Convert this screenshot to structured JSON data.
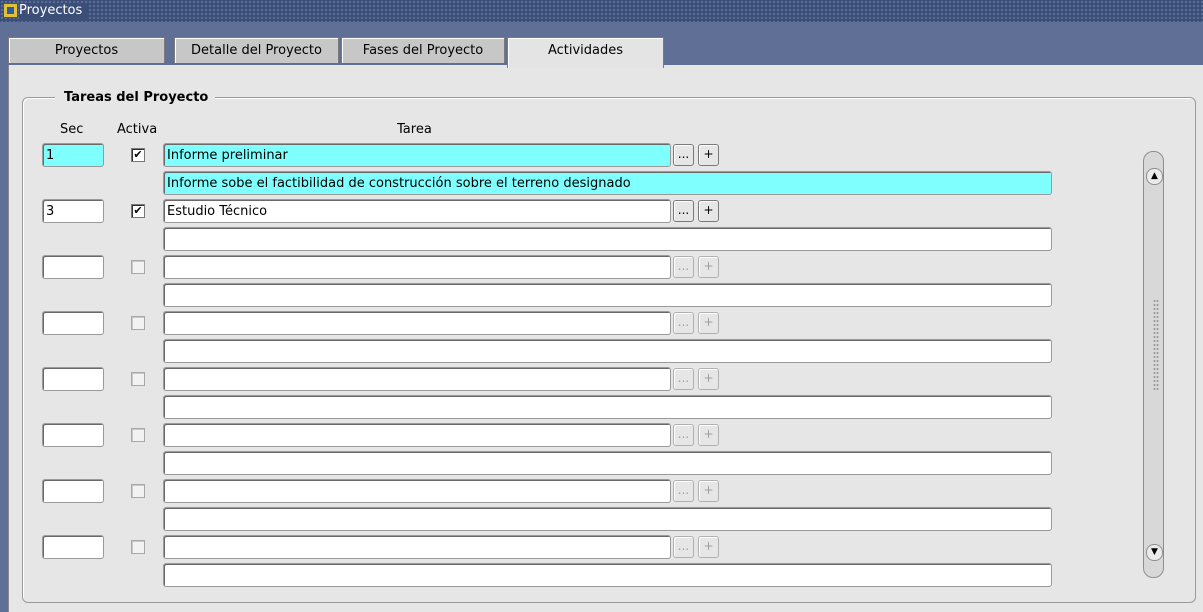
{
  "window": {
    "title": "Proyectos"
  },
  "tabs": [
    {
      "label": "Proyectos"
    },
    {
      "label": "Detalle del Proyecto"
    },
    {
      "label": "Fases del Proyecto"
    },
    {
      "label": "Actividades",
      "active": true
    }
  ],
  "group": {
    "title": "Tareas del Proyecto",
    "headers": {
      "sec": "Sec",
      "activa": "Activa",
      "tarea": "Tarea"
    }
  },
  "rows": [
    {
      "sec": "1",
      "activa": true,
      "tarea": "Informe preliminar",
      "descripcion": "Informe sobe el factibilidad de construcción sobre el terreno designado",
      "current": true
    },
    {
      "sec": "3",
      "activa": true,
      "tarea": "Estudio Técnico",
      "descripcion": ""
    },
    {
      "sec": "",
      "activa": false,
      "tarea": "",
      "descripcion": ""
    },
    {
      "sec": "",
      "activa": false,
      "tarea": "",
      "descripcion": ""
    },
    {
      "sec": "",
      "activa": false,
      "tarea": "",
      "descripcion": ""
    },
    {
      "sec": "",
      "activa": false,
      "tarea": "",
      "descripcion": ""
    },
    {
      "sec": "",
      "activa": false,
      "tarea": "",
      "descripcion": ""
    },
    {
      "sec": "",
      "activa": false,
      "tarea": "",
      "descripcion": ""
    }
  ],
  "buttons": {
    "lov": "...",
    "add": "+"
  },
  "checkmark": "✔",
  "scrollbar": {
    "up": "▲",
    "down": "▼"
  },
  "colors": {
    "highlight": "#80ffff",
    "titlebar": "#3a4e78",
    "tabstrip": "#5f6f96",
    "panel": "#e6e6e6"
  }
}
